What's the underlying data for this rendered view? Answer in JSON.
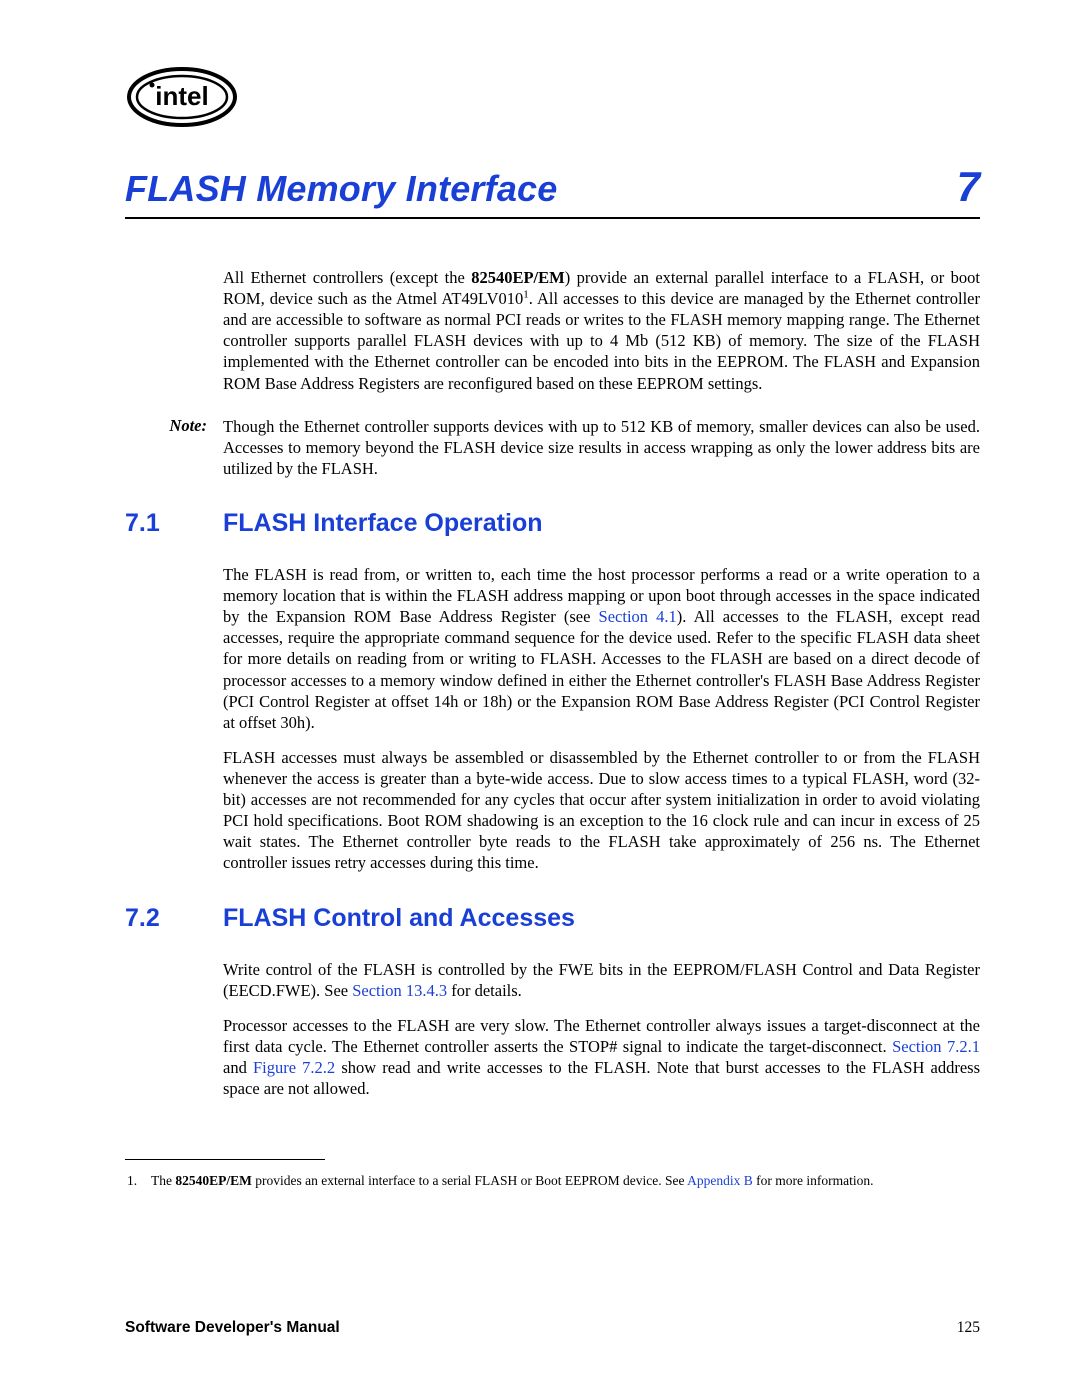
{
  "chapter": {
    "title": "FLASH Memory Interface",
    "number": "7"
  },
  "intro": {
    "p1_a": "All Ethernet controllers (except the ",
    "p1_bold1": "82540EP/EM",
    "p1_b": ") provide an external parallel interface to a FLASH, or boot ROM, device such as the Atmel AT49LV010",
    "p1_sup": "1",
    "p1_c": ". All accesses to this device are managed by the Ethernet controller and are accessible to software as normal PCI reads or writes to the FLASH memory mapping range. The Ethernet controller supports parallel FLASH devices with up to 4 Mb (512 KB) of memory. The size of the FLASH implemented with the Ethernet controller can be encoded into bits in the EEPROM. The FLASH and Expansion ROM Base Address Registers are reconfigured based on these EEPROM settings."
  },
  "note": {
    "label": "Note:",
    "text": "Though the Ethernet controller supports devices with up to 512 KB of memory, smaller devices can also be used. Accesses to memory beyond the FLASH device size results in access wrapping as only the lower address bits are utilized by the FLASH."
  },
  "sec71": {
    "num": "7.1",
    "title": "FLASH Interface Operation",
    "p1_a": "The FLASH is read from, or written to, each time the host processor performs a read or a write operation to a memory location that is within the FLASH address mapping or upon boot through accesses in the space indicated by the Expansion ROM Base Address Register (see ",
    "p1_xref": "Section 4.1",
    "p1_b": "). All accesses to the FLASH, except read accesses, require the appropriate command sequence for the device used. Refer to the specific FLASH data sheet for more details on reading from or writing to FLASH. Accesses to the FLASH are based on a direct decode of processor accesses to a memory window defined in either the Ethernet controller's FLASH Base Address Register (PCI Control Register at offset 14h or 18h) or the Expansion ROM Base Address Register (PCI Control Register at offset 30h).",
    "p2": "FLASH accesses must always be assembled or disassembled by the Ethernet controller to or from the FLASH whenever the access is greater than a byte-wide access. Due to slow access times to a typical FLASH, word (32-bit) accesses are not recommended for any cycles that occur after system initialization in order to avoid violating PCI hold specifications. Boot ROM shadowing is an exception to the 16 clock rule and can incur in excess of 25 wait states. The Ethernet controller byte reads to the FLASH take approximately of 256 ns. The Ethernet controller issues retry accesses during this time."
  },
  "sec72": {
    "num": "7.2",
    "title": "FLASH Control and Accesses",
    "p1_a": "Write control of the FLASH is controlled by the FWE bits in the EEPROM/FLASH Control and Data Register (EECD.FWE). See ",
    "p1_xref": "Section 13.4.3",
    "p1_b": " for details.",
    "p2_a": "Processor accesses to the FLASH are very slow. The Ethernet controller always issues a target-disconnect at the first data cycle. The Ethernet controller asserts the STOP# signal to indicate the target-disconnect. ",
    "p2_xref1": "Section 7.2.1",
    "p2_mid": " and ",
    "p2_xref2": "Figure 7.2.2",
    "p2_b": " show read and write accesses to the FLASH. Note that burst accesses to the FLASH address space are not allowed."
  },
  "footnote": {
    "num": "1.",
    "a": "The ",
    "bold": "82540EP/EM",
    "b": " provides an external interface to a serial FLASH or Boot EEPROM device. See ",
    "xref": "Appendix B",
    "c": " for more information."
  },
  "footer": {
    "left": "Software Developer's Manual",
    "right": "125"
  }
}
